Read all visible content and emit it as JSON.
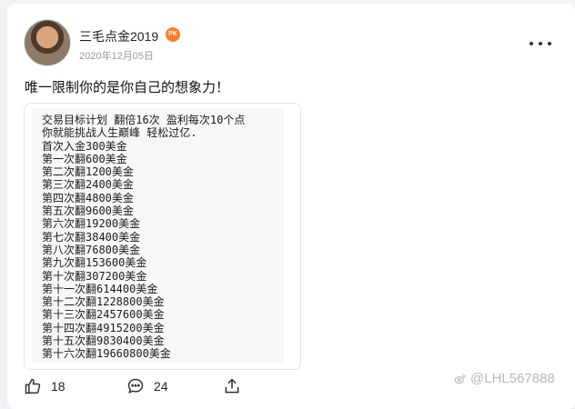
{
  "post": {
    "author": "三毛点金2019",
    "badge": "PK",
    "date": "2020年12月05日",
    "text": "唯一限制你的是你自己的想象力！"
  },
  "image_text": {
    "lines": [
      "交易目标计划 翻倍16次 盈利每次10个点",
      "你就能挑战人生巅峰  轻松过亿.",
      "首次入金300美金",
      "第一次翻600美金",
      "第二次翻1200美金",
      "第三次翻2400美金",
      "第四次翻4800美金",
      "第五次翻9600美金",
      "第六次翻19200美金",
      "第七次翻38400美金",
      "第八次翻76800美金",
      "第九次翻153600美金",
      "第十次翻307200美金",
      "第十一次翻614400美金",
      "第十二次翻1228800美金",
      "第十三次翻2457600美金",
      "第十四次翻4915200美金",
      "第十五次翻9830400美金",
      "第十六次翻19660800美金"
    ]
  },
  "actions": {
    "likes": "18",
    "comments": "24"
  },
  "watermark": "@LHL567888",
  "icons": {
    "like": "thumbs-up-icon",
    "comment": "comment-icon",
    "share": "share-icon",
    "more": "more-icon"
  },
  "colors": {
    "badge": "#ff7d29"
  }
}
